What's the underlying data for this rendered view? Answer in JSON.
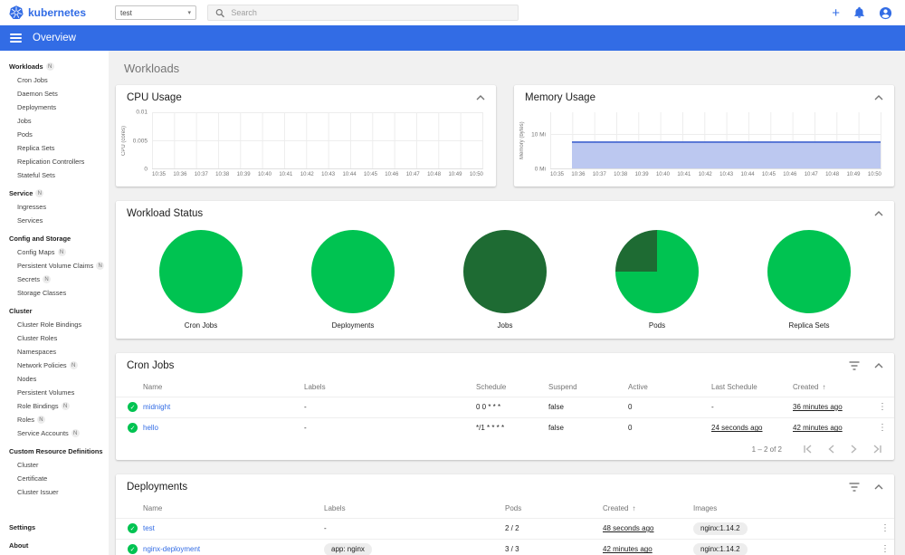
{
  "colors": {
    "brand": "#326ce5",
    "green": "#00c351",
    "dark_green": "#1e6b33",
    "link": "#326ce5",
    "area-fill": "#bcc8f0",
    "area-line": "#5b79d6",
    "chip-bg": "#ededed"
  },
  "icons": {
    "check": "✓",
    "kebab": "⋮",
    "sort_asc": "↑",
    "caret": "▾",
    "plus": "+"
  },
  "topbar": {
    "brand": "kubernetes",
    "namespace": {
      "value": "test"
    },
    "search": {
      "placeholder": "Search"
    }
  },
  "appbar": {
    "title": "Overview"
  },
  "sidebar": {
    "items": [
      {
        "type": "root",
        "label": "Workloads",
        "badge": "N"
      },
      {
        "type": "child",
        "label": "Cron Jobs"
      },
      {
        "type": "child",
        "label": "Daemon Sets"
      },
      {
        "type": "child",
        "label": "Deployments"
      },
      {
        "type": "child",
        "label": "Jobs"
      },
      {
        "type": "child",
        "label": "Pods"
      },
      {
        "type": "child",
        "label": "Replica Sets"
      },
      {
        "type": "child",
        "label": "Replication Controllers"
      },
      {
        "type": "child",
        "label": "Stateful Sets"
      },
      {
        "type": "root",
        "label": "Service",
        "badge": "N"
      },
      {
        "type": "child",
        "label": "Ingresses"
      },
      {
        "type": "child",
        "label": "Services"
      },
      {
        "type": "caption",
        "label": "Config and Storage",
        "clickable": "false"
      },
      {
        "type": "child",
        "label": "Config Maps",
        "badge": "N"
      },
      {
        "type": "child",
        "label": "Persistent Volume Claims",
        "badge": "N"
      },
      {
        "type": "child",
        "label": "Secrets",
        "badge": "N"
      },
      {
        "type": "child",
        "label": "Storage Classes"
      },
      {
        "type": "caption",
        "label": "Cluster",
        "clickable": "false"
      },
      {
        "type": "child",
        "label": "Cluster Role Bindings"
      },
      {
        "type": "child",
        "label": "Cluster Roles"
      },
      {
        "type": "child",
        "label": "Namespaces"
      },
      {
        "type": "child",
        "label": "Network Policies",
        "badge": "N"
      },
      {
        "type": "child",
        "label": "Nodes"
      },
      {
        "type": "child",
        "label": "Persistent Volumes"
      },
      {
        "type": "child",
        "label": "Role Bindings",
        "badge": "N"
      },
      {
        "type": "child",
        "label": "Roles",
        "badge": "N"
      },
      {
        "type": "child",
        "label": "Service Accounts",
        "badge": "N"
      },
      {
        "type": "caption",
        "label": "Custom Resource Definitions",
        "clickable": "false"
      },
      {
        "type": "child",
        "label": "Cluster"
      },
      {
        "type": "child",
        "label": "Certificate"
      },
      {
        "type": "child",
        "label": "Cluster Issuer"
      }
    ],
    "footer": [
      {
        "type": "root",
        "label": "Settings"
      },
      {
        "type": "root",
        "label": "About"
      }
    ]
  },
  "main": {
    "page_title": "Workloads",
    "cpu_card": {
      "title": "CPU Usage",
      "y_label": "CPU (cores)",
      "y_ticks": [
        {
          "label": "0.01",
          "pos": 0
        },
        {
          "label": "0.005",
          "pos": 50
        },
        {
          "label": "0",
          "pos": 100
        }
      ],
      "x_ticks": [
        "10:35",
        "10:36",
        "10:37",
        "10:38",
        "10:39",
        "10:40",
        "10:41",
        "10:42",
        "10:43",
        "10:44",
        "10:45",
        "10:46",
        "10:47",
        "10:48",
        "10:49",
        "10:50"
      ]
    },
    "memory_card": {
      "title": "Memory Usage",
      "y_label": "Memory (bytes)",
      "y_ticks": [
        {
          "label": "10 Mi",
          "pos": 40
        },
        {
          "label": "0 Mi",
          "pos": 100
        }
      ],
      "x_ticks": [
        "10:35",
        "10:36",
        "10:37",
        "10:38",
        "10:39",
        "10:40",
        "10:41",
        "10:42",
        "10:43",
        "10:44",
        "10:45",
        "10:46",
        "10:47",
        "10:48",
        "10:49",
        "10:50"
      ]
    },
    "workload_status": {
      "title": "Workload Status",
      "charts": [
        {
          "label": "Cron Jobs",
          "colors": [
            "#00c351"
          ]
        },
        {
          "label": "Deployments",
          "colors": [
            "#00c351"
          ]
        },
        {
          "label": "Jobs",
          "colors": [
            "#1e6b33"
          ]
        },
        {
          "label": "Pods",
          "colors": [
            "#1e6b33",
            "#00c351"
          ],
          "split_pct": 25
        },
        {
          "label": "Replica Sets",
          "colors": [
            "#00c351"
          ]
        }
      ]
    },
    "cron_jobs": {
      "title": "Cron Jobs",
      "columns": [
        "Name",
        "Labels",
        "Schedule",
        "Suspend",
        "Active",
        "Last Schedule",
        "Created"
      ],
      "rows": [
        {
          "name": "midnight",
          "labels": "-",
          "schedule": "0 0 * * *",
          "suspend": "false",
          "active": "0",
          "last_schedule": "-",
          "last_schedule_link": false,
          "created": "36 minutes ago",
          "created_link": true
        },
        {
          "name": "hello",
          "labels": "-",
          "schedule": "*/1 * * * *",
          "suspend": "false",
          "active": "0",
          "last_schedule": "24 seconds ago",
          "last_schedule_link": true,
          "created": "42 minutes ago",
          "created_link": true
        }
      ],
      "pagination": "1 – 2 of 2"
    },
    "deployments": {
      "title": "Deployments",
      "columns": [
        "Name",
        "Labels",
        "Pods",
        "Created",
        "Images"
      ],
      "rows": [
        {
          "name": "test",
          "labels": "-",
          "labels_chip": false,
          "pods": "2 / 2",
          "created": "48 seconds ago",
          "created_link": true,
          "images": "nginx:1.14.2"
        },
        {
          "name": "nginx-deployment",
          "labels": "app: nginx",
          "labels_chip": true,
          "pods": "3 / 3",
          "created": "42 minutes ago",
          "created_link": true,
          "images": "nginx:1.14.2"
        }
      ]
    }
  },
  "chart_data": [
    {
      "type": "area",
      "title": "CPU Usage",
      "ylabel": "CPU (cores)",
      "x": [
        "10:35",
        "10:36",
        "10:37",
        "10:38",
        "10:39",
        "10:40",
        "10:41",
        "10:42",
        "10:43",
        "10:44",
        "10:45",
        "10:46",
        "10:47",
        "10:48",
        "10:49",
        "10:50"
      ],
      "series": [
        {
          "name": "CPU usage",
          "values": [
            0,
            0,
            0,
            0,
            0,
            0,
            0,
            0,
            0,
            0,
            0,
            0,
            0,
            0,
            0,
            0
          ]
        }
      ],
      "ylim": [
        0,
        0.01
      ],
      "yticks": [
        "0",
        "0.005",
        "0.01"
      ],
      "grid": true,
      "legend": "none"
    },
    {
      "type": "area",
      "title": "Memory Usage",
      "ylabel": "Memory (bytes)",
      "x": [
        "10:35",
        "10:36",
        "10:37",
        "10:38",
        "10:39",
        "10:40",
        "10:41",
        "10:42",
        "10:43",
        "10:44",
        "10:45",
        "10:46",
        "10:47",
        "10:48",
        "10:49",
        "10:50"
      ],
      "series": [
        {
          "name": "Memory usage (Mi)",
          "values": [
            null,
            8,
            8,
            8,
            8,
            8,
            8,
            8,
            8,
            8,
            8,
            8,
            8,
            8,
            8.1,
            8.1
          ]
        }
      ],
      "ylim_mi": [
        0,
        16.7
      ],
      "yticks": [
        "0 Mi",
        "10 Mi"
      ],
      "grid": true,
      "legend": "none"
    },
    {
      "type": "pie",
      "title": "Cron Jobs",
      "slices": [
        {
          "pct": 100,
          "color": "#00c351"
        }
      ]
    },
    {
      "type": "pie",
      "title": "Deployments",
      "slices": [
        {
          "pct": 100,
          "color": "#00c351"
        }
      ]
    },
    {
      "type": "pie",
      "title": "Jobs",
      "slices": [
        {
          "pct": 100,
          "color": "#1e6b33"
        }
      ]
    },
    {
      "type": "pie",
      "title": "Pods",
      "slices": [
        {
          "pct": 25,
          "color": "#1e6b33"
        },
        {
          "pct": 75,
          "color": "#00c351"
        }
      ]
    },
    {
      "type": "pie",
      "title": "Replica Sets",
      "slices": [
        {
          "pct": 100,
          "color": "#00c351"
        }
      ]
    }
  ]
}
